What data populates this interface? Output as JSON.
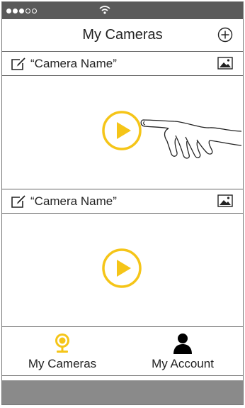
{
  "status_bar": {
    "signal_filled": 3,
    "signal_total": 5,
    "wifi_icon": "wifi-icon"
  },
  "nav": {
    "title": "My Cameras",
    "add_icon": "plus-circle-icon"
  },
  "cameras": [
    {
      "name": "“Camera Name”",
      "edit_icon": "edit-icon",
      "image_icon": "image-icon",
      "play_icon": "play-icon"
    },
    {
      "name": "“Camera Name”",
      "edit_icon": "edit-icon",
      "image_icon": "image-icon",
      "play_icon": "play-icon"
    }
  ],
  "tabs": [
    {
      "label": "My Cameras",
      "icon": "webcam-icon",
      "active": true
    },
    {
      "label": "My Account",
      "icon": "person-icon",
      "active": false
    }
  ],
  "colors": {
    "accent": "#F5C518",
    "status_bar": "#5a5a5a",
    "bottom_strip": "#8a8a8a"
  }
}
